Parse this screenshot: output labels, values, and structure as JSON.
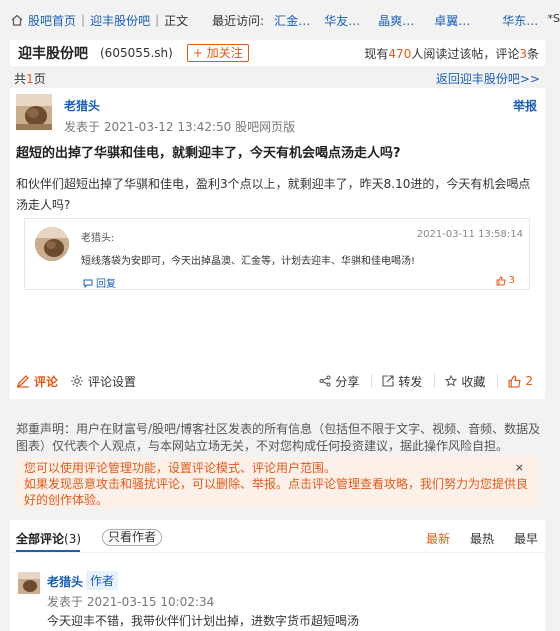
{
  "breadcrumb": {
    "home": "股吧首页",
    "bar": "迎丰股份吧",
    "current": "正文",
    "recent_label": "最近访问:",
    "recent": [
      "汇金…",
      "华友…",
      "晶爽…",
      "卓翼…",
      "华东…"
    ],
    "more": "*S"
  },
  "board": {
    "name": "迎丰股份吧",
    "code": "(605055.sh)",
    "follow": "+ 加关注",
    "stats_prefix": "现有",
    "readers": "470",
    "stats_mid": "人阅读过该帖，评论",
    "comments": "3",
    "stats_suffix": "条"
  },
  "paging": {
    "total_prefix": "共",
    "total_pages": "1",
    "total_suffix": "页",
    "back": "返回迎丰股份吧>>"
  },
  "post": {
    "author": "老猎头",
    "report": "举报",
    "meta": "发表于 2021-03-12 13:42:50 股吧网页版",
    "title": "超短的出掉了华骐和佳电，就剩迎丰了，今天有机会喝点汤走人吗?",
    "body": "和伙伴们超短出掉了华骐和佳电，盈利3个点以上，就剩迎丰了，昨天8.10进的，今天有机会喝点汤走人吗?"
  },
  "quote": {
    "author": "老猎头:",
    "time": "2021-03-11 13:58:14",
    "text": "短线落袋为安即可，今天出掉晶澳、汇金等，计划去迎丰、华骐和佳电喝汤!",
    "reply": "回复",
    "likes": "3"
  },
  "actions": {
    "comment": "评论",
    "settings": "评论设置",
    "share": "分享",
    "repost": "转发",
    "favorite": "收藏",
    "likes": "2"
  },
  "disclaimer": "郑重声明：用户在财富号/股吧/博客社区发表的所有信息（包括但不限于文字、视频、音频、数据及图表）仅代表个人观点，与本网站立场无关，不对您构成任何投资建议，据此操作风险自担。",
  "notice": {
    "line1": "您可以使用评论管理功能，设置评论模式、评论用户范围。",
    "line2": "如果发现恶意攻击和骚扰评论，可以删除、举报。点击评论管理查看攻略，我们努力为您提供良好的创作体验。",
    "close": "×"
  },
  "comments": {
    "tab_all": "全部评论",
    "tab_all_count": "(3)",
    "only_author": "只看作者",
    "sort_new": "最新",
    "sort_hot": "最热",
    "sort_early": "最早",
    "first": {
      "author": "老猎头",
      "tag": "作者",
      "meta": "发表于 2021-03-15 10:02:34",
      "text": "今天迎丰不错，我带伙伴们计划出掉，进数字货币超短喝汤"
    }
  },
  "colors": {
    "accent": "#e05a1c",
    "link": "#1a5fb4",
    "notice_bg": "#fdf0e8"
  }
}
